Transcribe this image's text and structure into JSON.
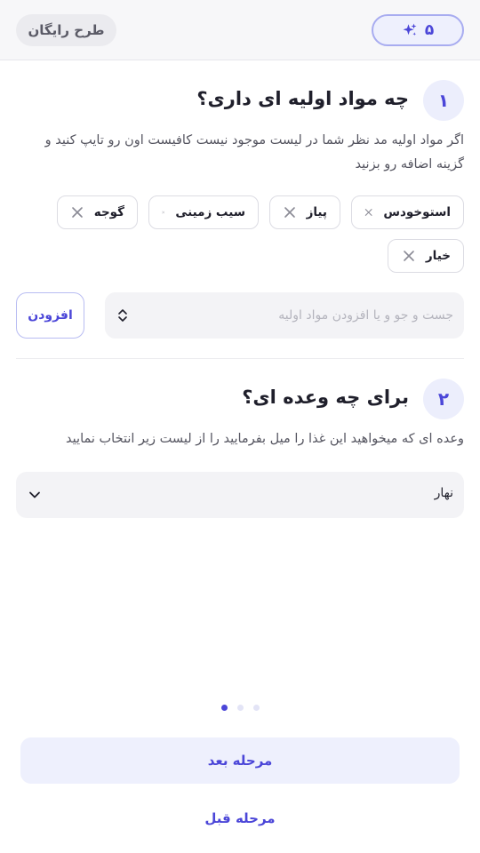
{
  "header": {
    "credits": "۵",
    "credits_icon": "sparkles-icon",
    "plan_label": "طرح رایگان"
  },
  "step1": {
    "number": "۱",
    "title": "چه مواد اولیه ای داری؟",
    "description": "اگر مواد اولیه مد نظر شما در لیست موجود نیست کافیست اون رو تایپ کنید و گزینه اضافه رو بزنید",
    "chips": [
      {
        "label": "استوخودس"
      },
      {
        "label": "پیاز"
      },
      {
        "label": "سیب زمینی"
      },
      {
        "label": "گوجه"
      },
      {
        "label": "خیار"
      }
    ],
    "search_placeholder": "جست و جو و یا افزودن مواد اولیه",
    "search_value": "",
    "add_label": "افزودن"
  },
  "step2": {
    "number": "۲",
    "title": "برای چه وعده ای؟",
    "description": "وعده ای که میخواهید این غذا را میل بفرمایید را از لیست زیر انتخاب نمایید",
    "selected_meal": "نهار"
  },
  "pager": {
    "current": 1,
    "total": 3
  },
  "footer": {
    "next_label": "مرحله بعد",
    "prev_label": "مرحله قبل"
  },
  "colors": {
    "accent": "#4b46d8",
    "accent_soft": "#eef0fd"
  }
}
